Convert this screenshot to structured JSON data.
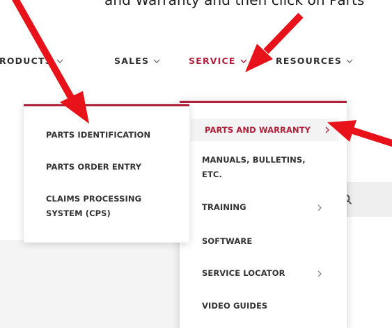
{
  "caption": "and Warranty and then click on Parts",
  "nav": {
    "products": "RODUCTS",
    "sales": "SALES",
    "service": "SERVICE",
    "resources": "RESOURCES"
  },
  "service_menu": {
    "items": [
      {
        "label": "PARTS AND WARRANTY",
        "has_submenu": true,
        "highlighted": true
      },
      {
        "label": "MANUALS, BULLETINS, ETC.",
        "has_submenu": false
      },
      {
        "label": "TRAINING",
        "has_submenu": true
      },
      {
        "label": "SOFTWARE",
        "has_submenu": false
      },
      {
        "label": "SERVICE LOCATOR",
        "has_submenu": true
      },
      {
        "label": "VIDEO GUIDES",
        "has_submenu": false
      }
    ]
  },
  "parts_submenu": {
    "items": [
      {
        "label": "PARTS IDENTIFICATION"
      },
      {
        "label": "PARTS ORDER ENTRY"
      },
      {
        "label": "CLAIMS PROCESSING SYSTEM (CPS)"
      }
    ]
  },
  "colors": {
    "accent": "#b0203a",
    "arrow": "#e8121a",
    "text": "#333333"
  },
  "icons": [
    "chevron-down-icon",
    "chevron-right-icon",
    "search-icon",
    "red-arrow-icon"
  ]
}
